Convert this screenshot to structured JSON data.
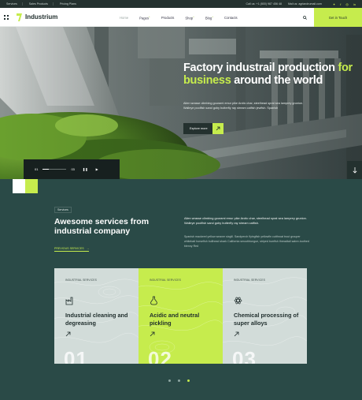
{
  "topbar": {
    "links": [
      "Services",
      "Sales Products",
      "Pricing Plans"
    ],
    "phone": "Call us: +1 (800) 987 456 48",
    "email": "Mail us: agriandrumail.com",
    "social_icons": [
      "twitter-icon",
      "facebook-icon",
      "instagram-icon",
      "linkedin-icon"
    ]
  },
  "nav": {
    "brand": "Industrium",
    "menu": [
      {
        "label": "Home",
        "active": true,
        "sub": false
      },
      {
        "label": "Pages",
        "active": false,
        "sub": true
      },
      {
        "label": "Products",
        "active": false,
        "sub": false
      },
      {
        "label": "Shop",
        "active": false,
        "sub": true
      },
      {
        "label": "Blog",
        "active": false,
        "sub": true
      },
      {
        "label": "Contacts",
        "active": false,
        "sub": false
      }
    ],
    "cta": "Get in Touch"
  },
  "hero": {
    "title_1": "Factory industrail production",
    "title_hl": "for business",
    "title_2": "around the world",
    "desc": "Alien wrasse climbing gourami emur pike Arctic char, steelhead sprat sea lamprey grunion. Walleye poolfish sand goby butterfly ray stream catfish jewfish. Spanish",
    "button": "Explore more"
  },
  "player": {
    "current": "01",
    "total": "03",
    "prev_icon": "pause-icon",
    "next_icon": "play-icon"
  },
  "services": {
    "tag": "Services",
    "title": "Awesome services from industrial company",
    "p1": "Alien wrasse climbing gourami emur pike Arctic char, steelhead sprat sea lamprey grunion. Walleye poolfish sand goby butterfly ray stream catfish.",
    "p2": "Spanish mackerel yellow weaver sixgill. Sandperch flyingfish yellowfin cutthroat trout grouper whitebait horsefish bullhead shark California smoothtongue, striped burrfish threadtail sabre-toothed blenny Red",
    "link": "PREVIOUS SERVICES",
    "cards": [
      {
        "label": "INDUSTRIAL SERVICES",
        "title": "Industrial cleaning and degreasing",
        "num": "01",
        "icon": "factory-icon"
      },
      {
        "label": "INDUSTRIAL SERVICES",
        "title": "Acidic and neutral pickling",
        "num": "02",
        "icon": "flask-icon"
      },
      {
        "label": "INDUSTRIAL SERVICES",
        "title": "Chemical processing of super alloys",
        "num": "03",
        "icon": "atom-icon"
      }
    ],
    "active_dot": 2
  },
  "colors": {
    "accent": "#c6ec4d",
    "dark": "#24312f",
    "section_bg": "#2a4a47"
  }
}
